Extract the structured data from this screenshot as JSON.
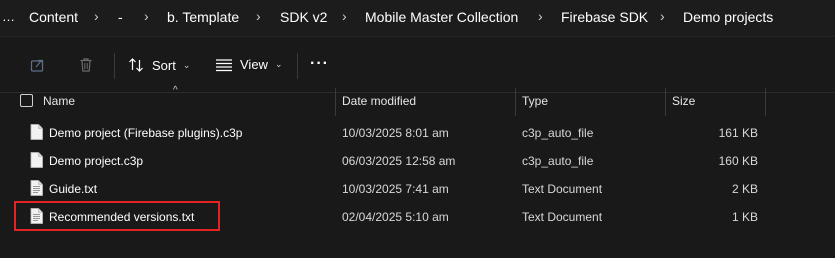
{
  "breadcrumb": {
    "overflow": "…",
    "items": [
      "Content",
      "-",
      "b. Template",
      "SDK v2",
      "Mobile Master Collection",
      "Firebase SDK",
      "Demo projects"
    ]
  },
  "toolbar": {
    "sort_label": "Sort",
    "view_label": "View",
    "more_label": "···"
  },
  "columns": {
    "name": "Name",
    "date_modified": "Date modified",
    "type": "Type",
    "size": "Size"
  },
  "files": [
    {
      "name": "Demo project (Firebase plugins).c3p",
      "date": "10/03/2025 8:01 am",
      "type": "c3p_auto_file",
      "size": "161 KB",
      "icon": "blank-file-icon"
    },
    {
      "name": "Demo project.c3p",
      "date": "06/03/2025 12:58 am",
      "type": "c3p_auto_file",
      "size": "160 KB",
      "icon": "blank-file-icon"
    },
    {
      "name": "Guide.txt",
      "date": "10/03/2025 7:41 am",
      "type": "Text Document",
      "size": "2 KB",
      "icon": "text-file-icon"
    },
    {
      "name": "Recommended versions.txt",
      "date": "02/04/2025 5:10 am",
      "type": "Text Document",
      "size": "1 KB",
      "icon": "text-file-icon"
    }
  ],
  "highlight_color": "#e32323"
}
